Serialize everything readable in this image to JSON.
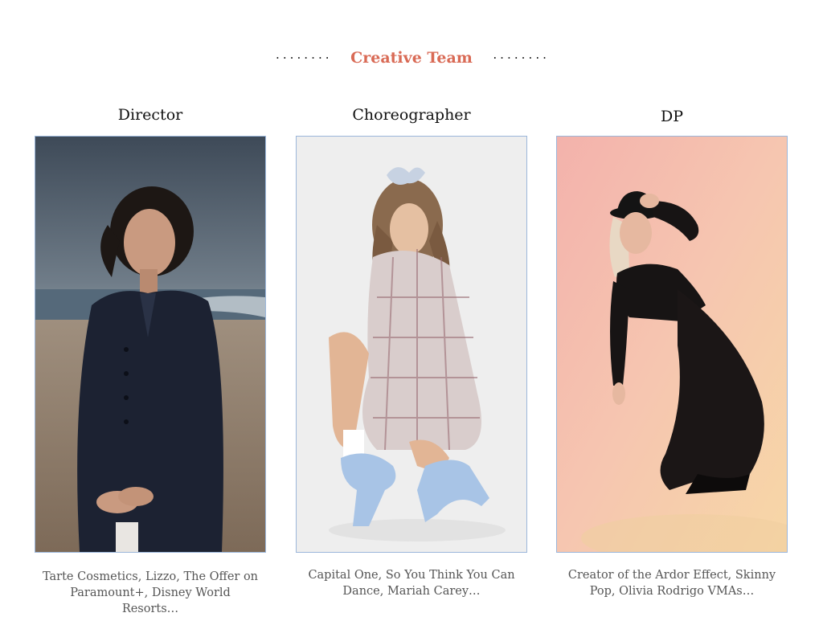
{
  "section": {
    "title": "Creative Team",
    "left_ornament": "........",
    "right_ornament": "........"
  },
  "team": [
    {
      "role": "Director",
      "credits": "Tarte Cosmetics, Lizzo, The Offer on Paramount+, Disney World Resorts…",
      "photo_icon": "director-portrait-beach"
    },
    {
      "role": "Choreographer",
      "credits": "Capital One, So You Think You Can Dance, Mariah Carey…",
      "photo_icon": "choreographer-portrait-studio"
    },
    {
      "role": "DP",
      "credits": "Creator of the Ardor Effect, Skinny Pop, Olivia Rodrigo VMAs…",
      "photo_icon": "dp-portrait-peach-backdrop"
    }
  ],
  "colors": {
    "accent": "#d96a55",
    "photo_border": "#9bb6da"
  }
}
